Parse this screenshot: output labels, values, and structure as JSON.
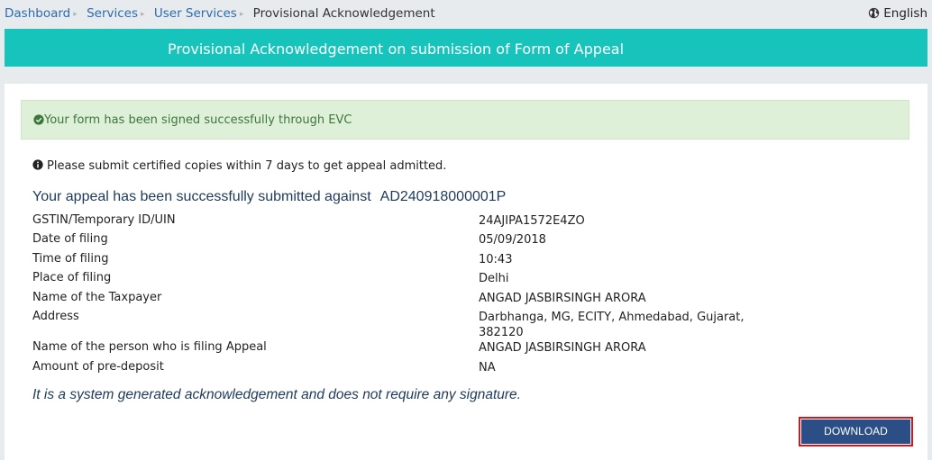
{
  "breadcrumb": {
    "items": [
      "Dashboard",
      "Services",
      "User Services"
    ],
    "current": "Provisional Acknowledgement"
  },
  "language": {
    "label": "English",
    "icon": "globe-icon"
  },
  "page": {
    "title": "Provisional Acknowledgement on submission of Form of Appeal"
  },
  "alert": {
    "message": "Your form has been signed successfully through EVC",
    "icon": "check-circle-icon"
  },
  "note": {
    "text": "Please submit certified copies within 7 days to get appeal admitted.",
    "icon": "info-icon"
  },
  "submission": {
    "heading": "Your appeal has been successfully submitted against",
    "arn": "AD240918000001P"
  },
  "details": [
    {
      "label": "GSTIN/Temporary ID/UIN",
      "value": "24AJIPA1572E4ZO"
    },
    {
      "label": "Date of filing",
      "value": "05/09/2018"
    },
    {
      "label": "Time of filing",
      "value": "10:43"
    },
    {
      "label": "Place of filing",
      "value": "Delhi"
    },
    {
      "label": "Name of the Taxpayer",
      "value": "ANGAD JASBIRSINGH ARORA"
    },
    {
      "label": "Address",
      "value": "Darbhanga, MG, ECITY, Ahmedabad, Gujarat, 382120"
    },
    {
      "label": "Name of the person who is filing Appeal",
      "value": "ANGAD JASBIRSINGH ARORA"
    },
    {
      "label": "Amount of pre-deposit",
      "value": "NA"
    }
  ],
  "footer": {
    "note": "It is a system generated acknowledgement and does not require any signature."
  },
  "actions": {
    "download_label": "DOWNLOAD"
  },
  "colors": {
    "header_teal": "#17c4bb",
    "button_blue": "#2c4e86",
    "alert_green": "#dff0d8"
  }
}
